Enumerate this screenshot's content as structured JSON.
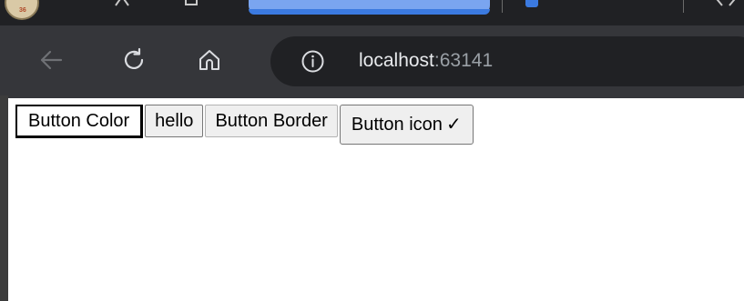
{
  "browser": {
    "address_bar": {
      "host": "localhost",
      "port": ":63141"
    },
    "icons": {
      "back": "arrow-left-icon",
      "reload": "reload-icon",
      "home": "home-icon",
      "site_info": "info-icon"
    },
    "colors": {
      "tab_strip": "#202124",
      "toolbar": "#35363a",
      "omnibox": "#202124",
      "active_tab": "#7aa5f0"
    }
  },
  "page": {
    "buttons": [
      {
        "label": "Button Color"
      },
      {
        "label": "hello"
      },
      {
        "label": "Button Border"
      },
      {
        "label": "Button icon",
        "icon": "✓"
      }
    ]
  }
}
